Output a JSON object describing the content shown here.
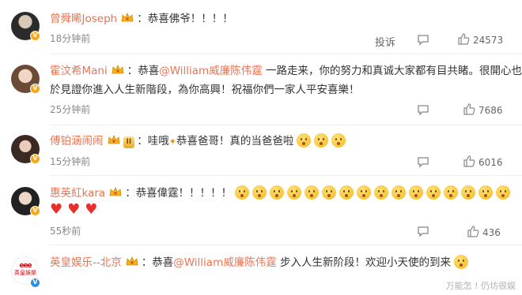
{
  "comments": [
    {
      "username": "曾舜晞Joseph",
      "text": "恭喜佛爷！！！！",
      "time": "18分钟前",
      "report_label": "投诉",
      "likes": "24573"
    },
    {
      "username": "霍汶希Mani",
      "text_pre": "恭喜",
      "mention": "@William威廉陈伟霆",
      "text_post": "一路走来，你的努力和真诚大家都有目共睹。很開心也终",
      "text_line2": "於見證你進入人生新階段，為你高興！祝福你們一家人平安喜樂！",
      "time": "25分钟前",
      "likes": "7686"
    },
    {
      "username": "傅铂涵闹闹",
      "level_badge": "II",
      "text_pre": "哇哦",
      "text_post": "恭喜爸哥！真的当爸爸啦",
      "time": "15分钟前",
      "likes": "6016"
    },
    {
      "username": "惠英紅kara",
      "text": "恭喜偉霆！！！！！",
      "time": "55秒前",
      "likes": "436"
    },
    {
      "username": "英皇娱乐--北京",
      "text_pre": "恭喜",
      "mention": "@William威廉陈伟霆",
      "text_post": "步入人生新阶段！欢迎小天使的到来",
      "avatar_text": "英皇娛樂"
    }
  ],
  "watermark": "万能怎 ! 仍坊很娱",
  "colors": {
    "username": "#eb7350",
    "time": "#888888",
    "text": "#333333"
  }
}
